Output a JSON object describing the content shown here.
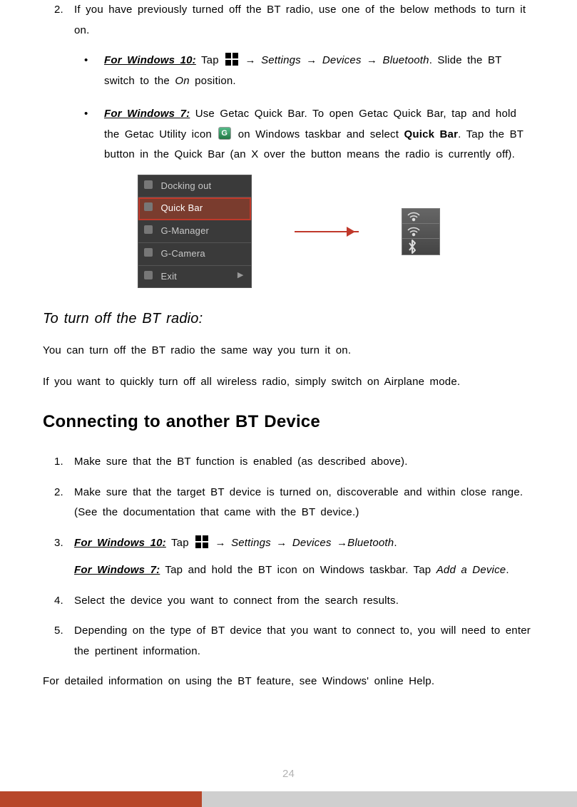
{
  "top": {
    "step2": {
      "num": "2.",
      "text": "If you have previously turned off the BT radio, use one of the below methods to turn it on."
    },
    "win10": {
      "label": "For Windows 10:",
      "tap": " Tap ",
      "arrow1": " → ",
      "settings": "Settings",
      "arrow2": " → ",
      "devices": "Devices",
      "arrow3": " → ",
      "bluetooth": "Bluetooth",
      "tail": ". Slide the BT switch to the ",
      "on": "On",
      "tail2": " position."
    },
    "win7": {
      "label": "For Windows 7:",
      "t1": " Use Getac Quick Bar. To open Getac Quick Bar, tap and hold the Getac Utility icon ",
      "t2": " on Windows taskbar and select ",
      "qb": "Quick Bar",
      "t3": ". Tap the BT button in the Quick Bar (an X over the button means the radio is currently off)."
    }
  },
  "menu": {
    "items": [
      "Docking out",
      "Quick Bar",
      "G-Manager",
      "G-Camera",
      "Exit"
    ]
  },
  "turnoff": {
    "heading": "To turn off the BT radio:",
    "p1": "You can turn off the BT radio the same way you turn it on.",
    "p2": "If you want to quickly turn off all wireless radio, simply switch on Airplane mode."
  },
  "connecting": {
    "heading": "Connecting to another BT Device",
    "s1": {
      "num": "1.",
      "text": "Make sure that the BT function is enabled (as described above)."
    },
    "s2": {
      "num": "2.",
      "text": "Make sure that the target BT device is turned on, discoverable and within close range. (See the documentation that came with the BT device.)"
    },
    "s3": {
      "num": "3.",
      "w10label": "For Windows 10:",
      "tap": "  Tap ",
      "arrow1": " → ",
      "settings": "Settings",
      "arrow2": " → ",
      "devices": " Devices ",
      "arrow3": " →",
      "bluetooth": "Bluetooth",
      "dot": ".",
      "w7label": "For Windows 7:",
      "w7text": " Tap and hold the BT icon on Windows taskbar. Tap ",
      "adddevice": "Add a Device",
      "dot2": "."
    },
    "s4": {
      "num": "4.",
      "text": "Select the device you want to connect from the search results."
    },
    "s5": {
      "num": "5.",
      "text": "Depending on the type of BT device that you want to connect to, you will need to enter the pertinent information."
    },
    "tail": "For detailed information on using the BT feature, see Windows' online Help."
  },
  "pageNum": "24"
}
